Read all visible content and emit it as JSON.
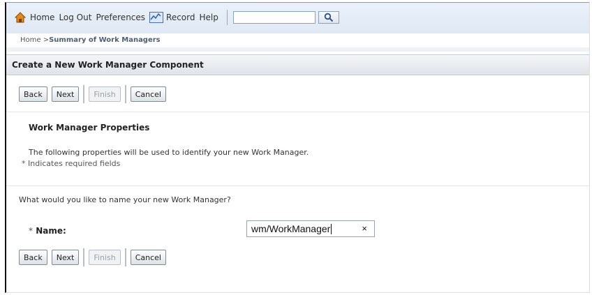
{
  "topnav": {
    "home": "Home",
    "logout": "Log Out",
    "preferences": "Preferences",
    "record": "Record",
    "help": "Help",
    "search_value": "",
    "icons": [
      "home-icon",
      "record-icon",
      "search-icon"
    ]
  },
  "breadcrumb": {
    "home": "Home >",
    "current": "Summary of Work Managers"
  },
  "page": {
    "title": "Create a New Work Manager Component"
  },
  "buttons": {
    "back": "Back",
    "next": "Next",
    "finish": "Finish",
    "cancel": "Cancel"
  },
  "section": {
    "title": "Work Manager Properties",
    "description": "The following properties will be used to identify your new Work Manager.",
    "required_note": "* Indicates required fields",
    "question": "What would you like to name your new Work Manager?"
  },
  "form": {
    "name_label": "Name:",
    "required_marker": "*",
    "name_value": "wm/WorkManager",
    "clear_glyph": "×"
  },
  "colors": {
    "topbar": "#e4ecf7",
    "header_bar": "#e6e9ed",
    "breadcrumb_current": "#4d5e74"
  }
}
